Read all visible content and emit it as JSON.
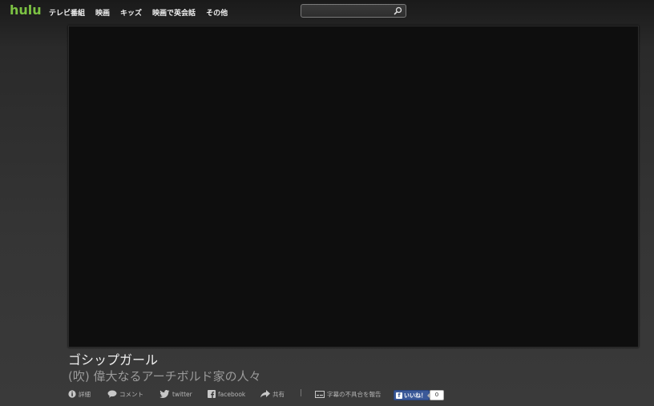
{
  "header": {
    "logo": "hulu",
    "nav": [
      {
        "label": "テレビ番組"
      },
      {
        "label": "映画"
      },
      {
        "label": "キッズ"
      },
      {
        "label": "映画で英会話"
      },
      {
        "label": "その他"
      }
    ],
    "search": {
      "value": "",
      "placeholder": "",
      "icon": "search-icon"
    }
  },
  "video": {
    "show_title": "ゴシップガール",
    "episode_title": "(吹) 偉大なるアーチボルド家の人々"
  },
  "actions": {
    "details": {
      "label": "詳細",
      "icon": "info-icon"
    },
    "comment": {
      "label": "コメント",
      "icon": "comment-icon"
    },
    "twitter": {
      "label": "twitter",
      "icon": "twitter-icon"
    },
    "facebook": {
      "label": "facebook",
      "icon": "facebook-icon"
    },
    "share": {
      "label": "共有",
      "icon": "share-icon"
    },
    "separator": "|",
    "report": {
      "label": "字幕の不具合を報告",
      "icon": "subtitle-icon"
    },
    "like": {
      "label": "いいね！",
      "count": "0",
      "icon": "facebook-like-icon"
    }
  },
  "colors": {
    "brand": "#7cc243",
    "facebook": "#3b5998",
    "player_bg": "#0e0e0e"
  }
}
